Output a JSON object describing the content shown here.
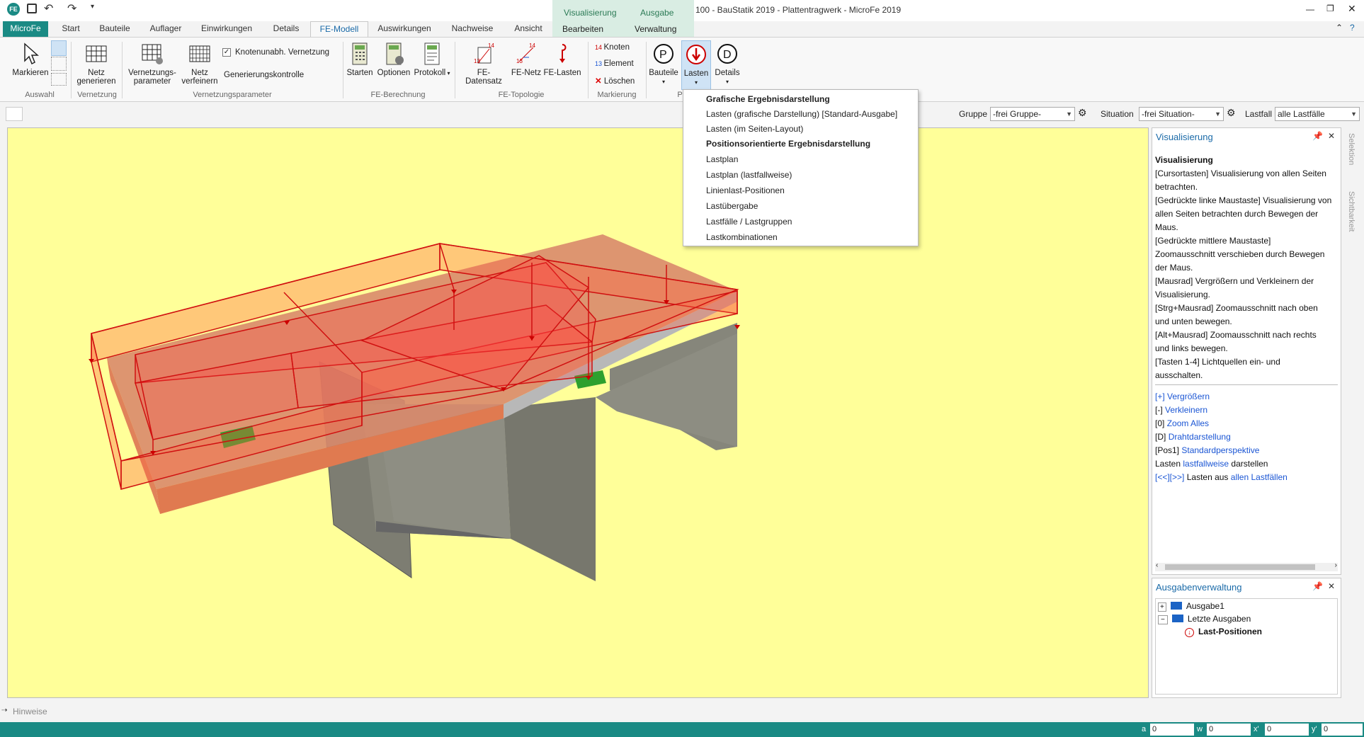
{
  "window": {
    "title": "100 - BauStatik 2019 - Plattentragwerk - MicroFe 2019",
    "quick_access": [
      "save-icon",
      "undo-icon",
      "redo-icon",
      "customize-icon"
    ]
  },
  "context_group": {
    "top_tabs": [
      "Visualisierung",
      "Ausgabe"
    ],
    "bottom_tabs": [
      "Bearbeiten",
      "Verwaltung"
    ]
  },
  "ribbon_tabs": [
    "MicroFe",
    "Start",
    "Bauteile",
    "Auflager",
    "Einwirkungen",
    "Details",
    "FE-Modell",
    "Auswirkungen",
    "Nachweise",
    "Ansicht"
  ],
  "ribbon_active_tab": "FE-Modell",
  "ribbon": {
    "auswahl": {
      "markieren": "Markieren",
      "group": "Auswahl"
    },
    "vernetzung": {
      "netz_line1": "Netz",
      "netz_line2": "generieren",
      "group": "Vernetzung"
    },
    "vernetzungsparameter": {
      "param_line1": "Vernetzungs-",
      "param_line2": "parameter",
      "verfeinern_line1": "Netz",
      "verfeinern_line2": "verfeinern",
      "knotenunabh": "Knotenunabh. Vernetzung",
      "generierungskontrolle": "Generierungskontrolle",
      "group": "Vernetzungsparameter"
    },
    "fe_berechnung": {
      "starten": "Starten",
      "optionen": "Optionen",
      "protokoll": "Protokoll",
      "group": "FE-Berechnung"
    },
    "fe_topologie": {
      "datensatz": "FE-Datensatz",
      "netz": "FE-Netz",
      "lasten": "FE-Lasten",
      "group": "FE-Topologie"
    },
    "markierung": {
      "knoten": "Knoten",
      "element": "Element",
      "loeschen": "Löschen",
      "group": "Markierung"
    },
    "ausgabe": {
      "bauteile": "Bauteile",
      "lasten": "Lasten",
      "details": "Details",
      "group_initial": "P"
    }
  },
  "dropdown": {
    "items": [
      {
        "label": "Grafische Ergebnisdarstellung",
        "bold": true
      },
      {
        "label": "Lasten (grafische Darstellung) [Standard-Ausgabe]",
        "bold": false
      },
      {
        "label": "Lasten (im Seiten-Layout)",
        "bold": false
      },
      {
        "label": "Positionsorientierte Ergebnisdarstellung",
        "bold": true
      },
      {
        "label": "Lastplan",
        "bold": false
      },
      {
        "label": "Lastplan (lastfallweise)",
        "bold": false
      },
      {
        "label": "Linienlast-Positionen",
        "bold": false
      },
      {
        "label": "Lastübergabe",
        "bold": false
      },
      {
        "label": "Lastfälle / Lastgruppen",
        "bold": false
      },
      {
        "label": "Lastkombinationen",
        "bold": false
      }
    ]
  },
  "filters": {
    "gruppe_label": "Gruppe",
    "gruppe_value": "-frei Gruppe-",
    "situation_label": "Situation",
    "situation_value": "-frei Situation-",
    "lastfall_label": "Lastfall",
    "lastfall_value": "alle Lastfälle"
  },
  "visualisierung_panel": {
    "title": "Visualisierung",
    "heading": "Visualisierung",
    "lines": [
      "[Cursortasten] Visualisierung von allen Seiten",
      "betrachten.",
      "[Gedrückte linke Maustaste] Visualisierung von",
      "allen Seiten betrachten durch Bewegen der",
      "Maus.",
      "[Gedrückte mittlere Maustaste]",
      "Zoomausschnitt verschieben durch Bewegen",
      "der Maus.",
      "[Mausrad] Vergrößern und Verkleinern der",
      "Visualisierung.",
      "[Strg+Mausrad] Zoomausschnitt nach oben",
      "und unten bewegen.",
      "[Alt+Mausrad] Zoomausschnitt nach rechts",
      "und links bewegen.",
      "[Tasten 1-4] Lichtquellen ein- und",
      "ausschalten."
    ],
    "links": {
      "plus_key": "[+]",
      "plus": "Vergrößern",
      "minus_key": "[-]",
      "minus": "Verkleinern",
      "zero_key": "[0]",
      "zero": "Zoom Alles",
      "d_key": "[D]",
      "d": "Drahtdarstellung",
      "pos1_key": "[Pos1]",
      "pos1": "Standardperspektive",
      "lasten_pre": "Lasten",
      "lasten_link": "lastfallweise",
      "lasten_post": "darstellen",
      "nav_link": "[<<][>>]",
      "nav_mid": "Lasten aus",
      "nav_link2": "allen Lastfällen"
    }
  },
  "ausgaben_panel": {
    "title": "Ausgabenverwaltung",
    "tree": [
      "Ausgabe1",
      "Letzte Ausgaben",
      "Last-Positionen"
    ]
  },
  "side_tabs": [
    "Selektion",
    "Sichtbarkeit"
  ],
  "hinweise": "Hinweise",
  "statusbar": {
    "a_label": "a",
    "a_value": "0",
    "w_label": "w",
    "w_value": "0",
    "x_label": "x'",
    "x_value": "0",
    "y_label": "y'",
    "y_value": "0"
  },
  "colors": {
    "accent": "#1a8a84",
    "viewport_bg": "#ffff99",
    "link": "#1a55d4"
  }
}
